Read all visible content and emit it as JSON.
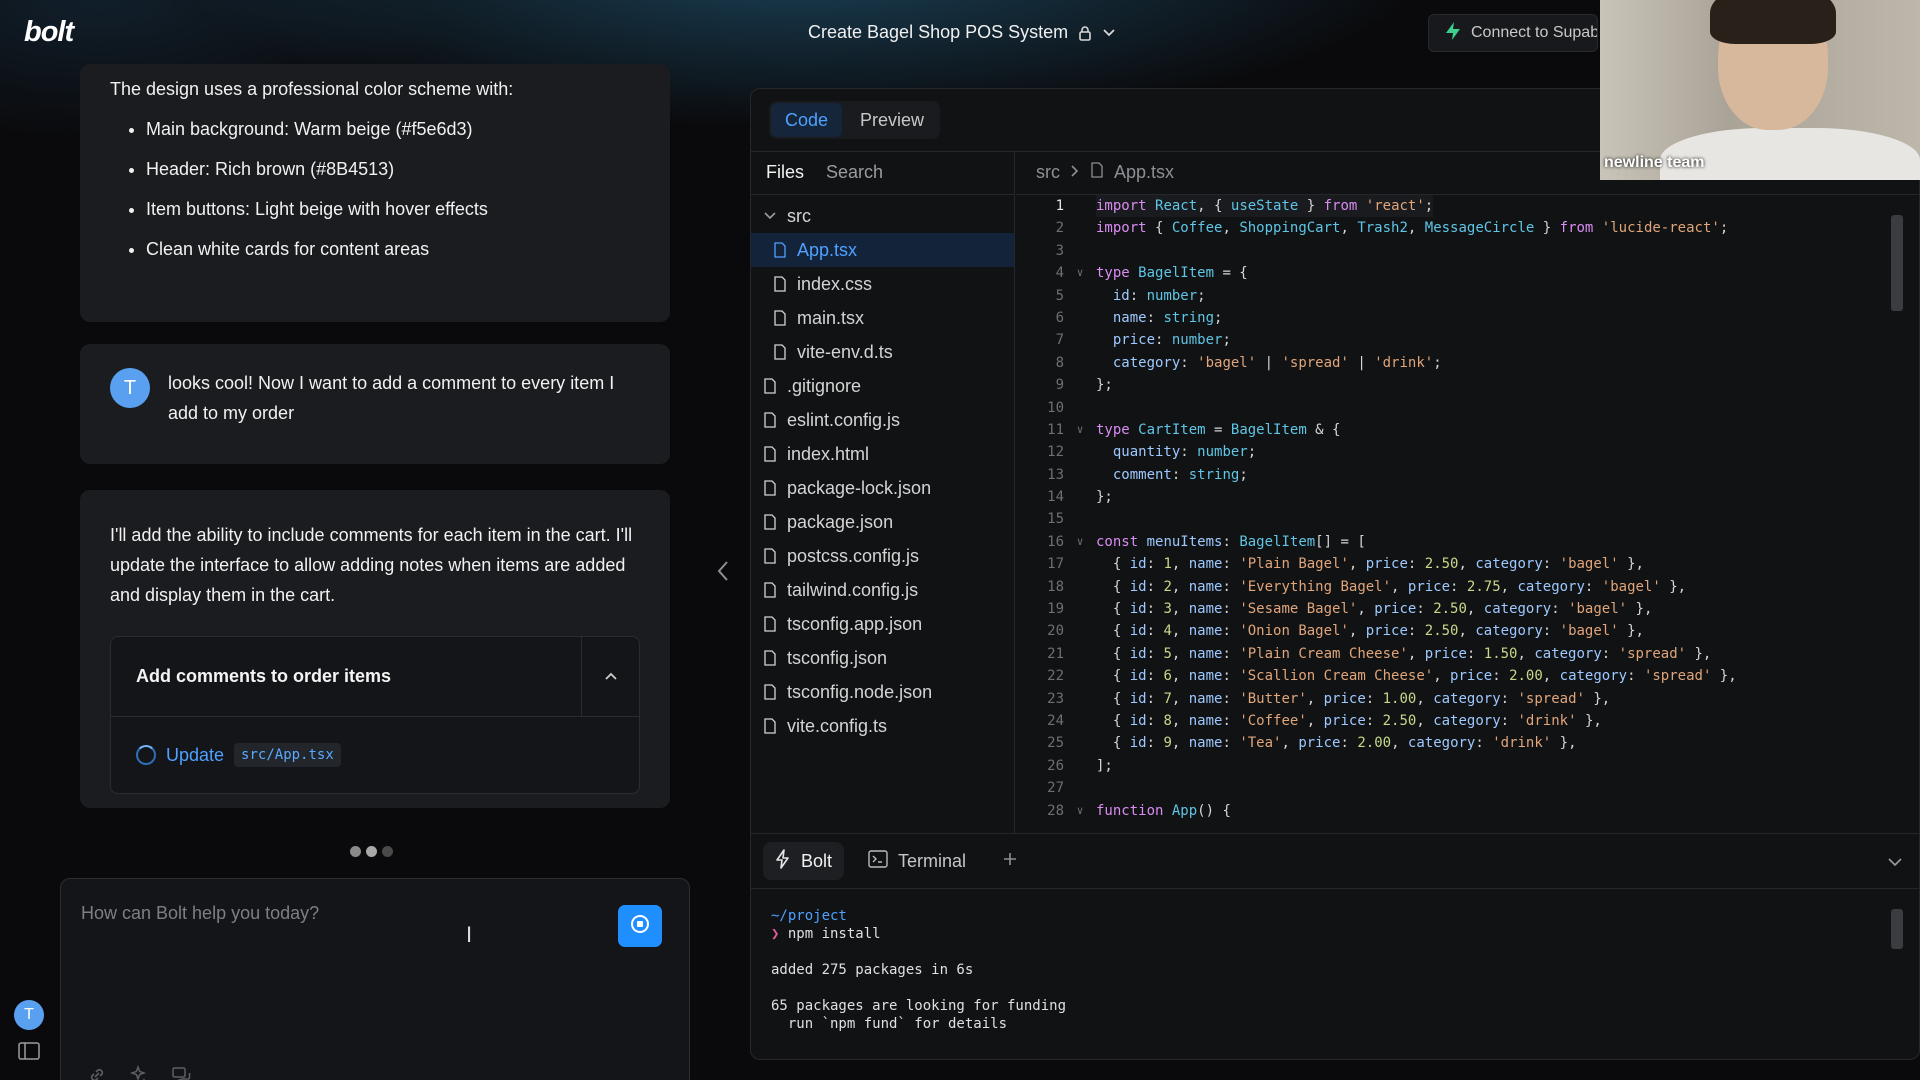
{
  "header": {
    "logo": "bolt",
    "project_title": "Create Bagel Shop POS System",
    "supabase_button": "Connect to Supabase"
  },
  "chat": {
    "assistant_msg_1": {
      "intro": "The design uses a professional color scheme with:",
      "bullets": [
        "Main background: Warm beige (#f5e6d3)",
        "Header: Rich brown (#8B4513)",
        "Item buttons: Light beige with hover effects",
        "Clean white cards for content areas"
      ]
    },
    "user_msg": {
      "avatar_letter": "T",
      "text": "looks cool! Now I want to add a comment to every item I add to my order"
    },
    "assistant_msg_2": {
      "text": "I'll add the ability to include comments for each item in the cart. I'll update the interface to allow adding notes when items are added and display them in the cart.",
      "artifact": {
        "title": "Add comments to order items",
        "action_label": "Update",
        "action_file": "src/App.tsx"
      }
    },
    "input": {
      "placeholder": "How can Bolt help you today?"
    },
    "user_avatar_letter": "T"
  },
  "workbench": {
    "tabs": [
      "Code",
      "Preview"
    ],
    "active_tab": "Code",
    "filetree_tabs": [
      "Files",
      "Search"
    ],
    "files": [
      {
        "name": "src",
        "type": "folder",
        "level": 0
      },
      {
        "name": "App.tsx",
        "type": "file",
        "level": 1,
        "active": true
      },
      {
        "name": "index.css",
        "type": "file",
        "level": 1
      },
      {
        "name": "main.tsx",
        "type": "file",
        "level": 1
      },
      {
        "name": "vite-env.d.ts",
        "type": "file",
        "level": 1
      },
      {
        "name": ".gitignore",
        "type": "file",
        "level": 0
      },
      {
        "name": "eslint.config.js",
        "type": "file",
        "level": 0
      },
      {
        "name": "index.html",
        "type": "file",
        "level": 0
      },
      {
        "name": "package-lock.json",
        "type": "file",
        "level": 0
      },
      {
        "name": "package.json",
        "type": "file",
        "level": 0
      },
      {
        "name": "postcss.config.js",
        "type": "file",
        "level": 0
      },
      {
        "name": "tailwind.config.js",
        "type": "file",
        "level": 0
      },
      {
        "name": "tsconfig.app.json",
        "type": "file",
        "level": 0
      },
      {
        "name": "tsconfig.json",
        "type": "file",
        "level": 0
      },
      {
        "name": "tsconfig.node.json",
        "type": "file",
        "level": 0
      },
      {
        "name": "vite.config.ts",
        "type": "file",
        "level": 0
      }
    ],
    "breadcrumb": [
      "src",
      "App.tsx"
    ],
    "code_lines": [
      "import React, { useState } from 'react';",
      "import { Coffee, ShoppingCart, Trash2, MessageCircle } from 'lucide-react';",
      "",
      "type BagelItem = {",
      "  id: number;",
      "  name: string;",
      "  price: number;",
      "  category: 'bagel' | 'spread' | 'drink';",
      "};",
      "",
      "type CartItem = BagelItem & {",
      "  quantity: number;",
      "  comment: string;",
      "};",
      "",
      "const menuItems: BagelItem[] = [",
      "  { id: 1, name: 'Plain Bagel', price: 2.50, category: 'bagel' },",
      "  { id: 2, name: 'Everything Bagel', price: 2.75, category: 'bagel' },",
      "  { id: 3, name: 'Sesame Bagel', price: 2.50, category: 'bagel' },",
      "  { id: 4, name: 'Onion Bagel', price: 2.50, category: 'bagel' },",
      "  { id: 5, name: 'Plain Cream Cheese', price: 1.50, category: 'spread' },",
      "  { id: 6, name: 'Scallion Cream Cheese', price: 2.00, category: 'spread' },",
      "  { id: 7, name: 'Butter', price: 1.00, category: 'spread' },",
      "  { id: 8, name: 'Coffee', price: 2.50, category: 'drink' },",
      "  { id: 9, name: 'Tea', price: 2.00, category: 'drink' },",
      "];",
      "",
      "function App() {"
    ],
    "foldable_lines": [
      4,
      11,
      16,
      28
    ],
    "current_line": 1,
    "bottom_tabs": [
      "Bolt",
      "Terminal"
    ],
    "terminal": [
      "~/project",
      "npm install",
      "",
      "added 275 packages in 6s",
      "",
      "65 packages are looking for funding",
      "  run `npm fund` for details"
    ]
  },
  "webcam": {
    "name": "newline team"
  }
}
